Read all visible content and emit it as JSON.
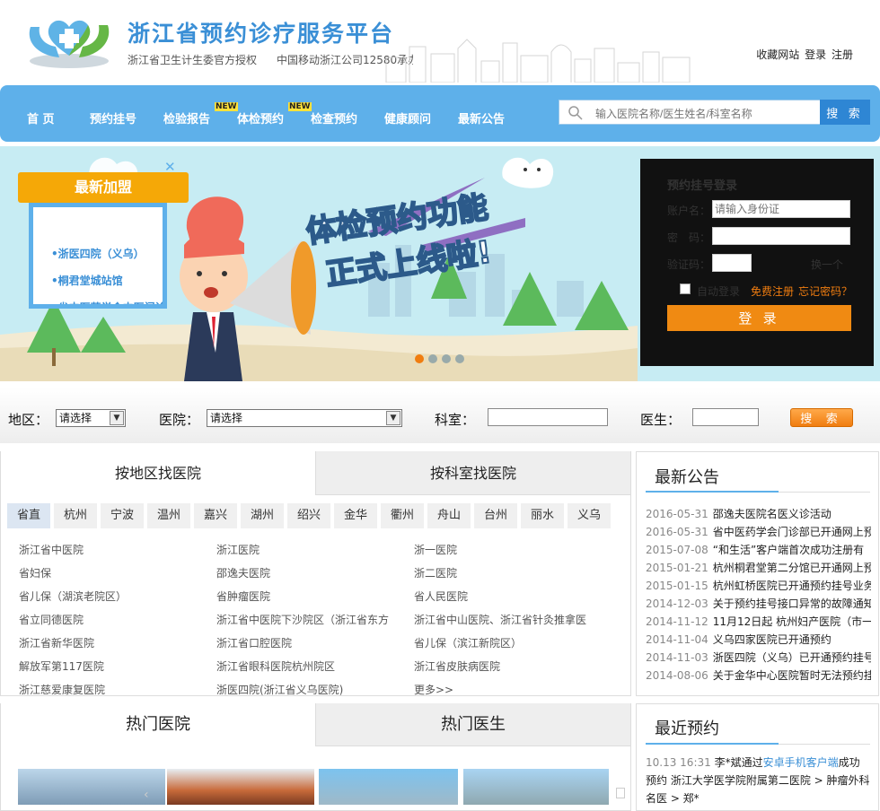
{
  "header": {
    "site_title": "浙江省预约诊疗服务平台",
    "subtitle_authority": "浙江省卫生计生委官方授权",
    "subtitle_operator": "中国移动浙江公司12580承办",
    "top_links": [
      "收藏网站",
      "登录",
      "注册"
    ]
  },
  "nav": {
    "items": [
      "首 页",
      "预约挂号",
      "检验报告",
      "体检预约",
      "检查预约",
      "健康顾问",
      "最新公告"
    ],
    "new_badge": "NEW",
    "search_placeholder": "输入医院名称/医生姓名/科室名称",
    "search_button": "搜 索"
  },
  "banner": {
    "slogan_line1": "体检预约功能",
    "slogan_line2": "正式上线啦!",
    "newjoin_title": "最新加盟",
    "newjoin_items": [
      "•浙医四院（义乌）",
      "•桐君堂城站馆",
      "•省中医药学会中医门诊"
    ]
  },
  "login": {
    "title": "预约挂号登录",
    "account_label": "账户名：",
    "account_placeholder": "请输入身份证",
    "password_label": "密　码：",
    "captcha_label": "验证码：",
    "refresh_captcha": "换一个",
    "auto_login": "自动登录",
    "free_register": "免费注册",
    "forgot_password": "忘记密码？",
    "submit": "登 录"
  },
  "filter": {
    "region_label": "地区：",
    "region_value": "请选择",
    "hospital_label": "医院：",
    "hospital_value": "请选择",
    "dept_label": "科室：",
    "doctor_label": "医生：",
    "search_button": "搜 索"
  },
  "hospitals": {
    "tabs": [
      "按地区找医院",
      "按科室找医院"
    ],
    "regions": [
      "省直",
      "杭州",
      "宁波",
      "温州",
      "嘉兴",
      "湖州",
      "绍兴",
      "金华",
      "衢州",
      "舟山",
      "台州",
      "丽水",
      "义乌"
    ],
    "list": [
      [
        "浙江省中医院",
        "浙江医院",
        "浙一医院"
      ],
      [
        "省妇保",
        "邵逸夫医院",
        "浙二医院"
      ],
      [
        "省儿保（湖滨老院区）",
        "省肿瘤医院",
        "省人民医院"
      ],
      [
        "省立同德医院",
        "浙江省中医院下沙院区（浙江省东方",
        "浙江省中山医院、浙江省针灸推拿医"
      ],
      [
        "浙江省新华医院",
        "浙江省口腔医院",
        "省儿保（滨江新院区）"
      ],
      [
        "解放军第117医院",
        "浙江省眼科医院杭州院区",
        "浙江省皮肤病医院"
      ],
      [
        "浙江慈爱康复医院",
        "浙医四院(浙江省义乌医院)",
        "更多>>"
      ]
    ]
  },
  "notices": {
    "title": "最新公告",
    "items": [
      {
        "date": "2016-05-31",
        "text": "邵逸夫医院名医义诊活动"
      },
      {
        "date": "2016-05-31",
        "text": "省中医药学会门诊部已开通网上预"
      },
      {
        "date": "2015-07-08",
        "text": "“和生活”客户端首次成功注册有"
      },
      {
        "date": "2015-01-21",
        "text": "杭州桐君堂第二分馆已开通网上预"
      },
      {
        "date": "2015-01-15",
        "text": "杭州虹桥医院已开通预约挂号业务"
      },
      {
        "date": "2014-12-03",
        "text": "关于预约挂号接口异常的故障通知"
      },
      {
        "date": "2014-11-12",
        "text": "11月12日起 杭州妇产医院（市一"
      },
      {
        "date": "2014-11-04",
        "text": "义乌四家医院已开通预约"
      },
      {
        "date": "2014-11-03",
        "text": "浙医四院（义乌）已开通预约挂号"
      },
      {
        "date": "2014-08-06",
        "text": "关于金华中心医院暂时无法预约挂"
      }
    ]
  },
  "hot": {
    "tabs": [
      "热门医院",
      "热门医生"
    ]
  },
  "recent": {
    "title": "最近预约",
    "time": "10.13 16:31",
    "user": "李*斌通过",
    "channel": "安卓手机客户端",
    "status": "成功",
    "line2": "预约 浙江大学医学院附属第二医院 > 肿瘤外科",
    "line3": "名医 > 郑*"
  }
}
